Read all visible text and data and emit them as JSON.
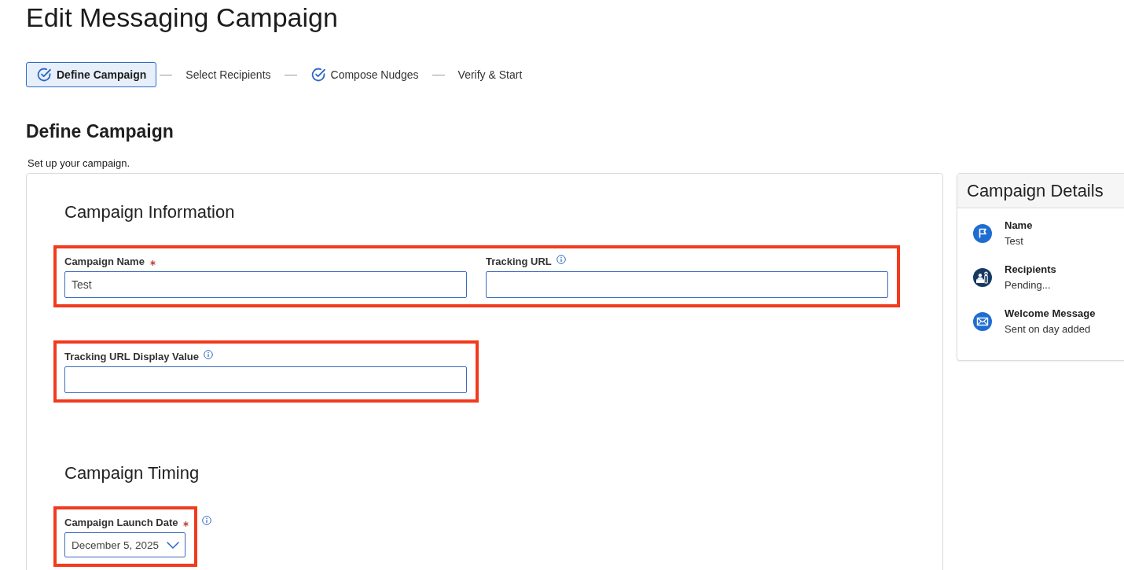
{
  "page": {
    "title": "Edit Messaging Campaign"
  },
  "steps": [
    {
      "label": "Define Campaign",
      "selected": true,
      "complete": true
    },
    {
      "label": "Select Recipients",
      "selected": false,
      "complete": false
    },
    {
      "label": "Compose Nudges",
      "selected": false,
      "complete": true
    },
    {
      "label": "Verify & Start",
      "selected": false,
      "complete": false
    }
  ],
  "section": {
    "title": "Define Campaign",
    "subtitle": "Set up your campaign."
  },
  "form": {
    "groups": [
      {
        "title": "Campaign Information",
        "rows": [
          {
            "highlighted": true,
            "fields": [
              {
                "kind": "text",
                "label": "Campaign Name",
                "required": true,
                "info": false,
                "value": "Test"
              },
              {
                "kind": "text",
                "label": "Tracking URL",
                "required": false,
                "info": true
              }
            ]
          },
          {
            "highlighted": true,
            "fields": [
              {
                "kind": "text",
                "label": "Tracking URL Display Value",
                "required": false,
                "info": true
              }
            ]
          }
        ]
      },
      {
        "title": "Campaign Timing",
        "rows": [
          {
            "highlighted": true,
            "fields": [
              {
                "kind": "select",
                "label": "Campaign Launch Date",
                "required": true,
                "info": true,
                "value": "December 5, 2025"
              }
            ]
          }
        ]
      }
    ]
  },
  "details": {
    "title": "Campaign Details",
    "items": [
      {
        "label": "Name",
        "value": "Test"
      },
      {
        "label": "Recipients",
        "value": "Pending..."
      },
      {
        "label": "Welcome Message",
        "value": "Sent on day added"
      }
    ]
  }
}
